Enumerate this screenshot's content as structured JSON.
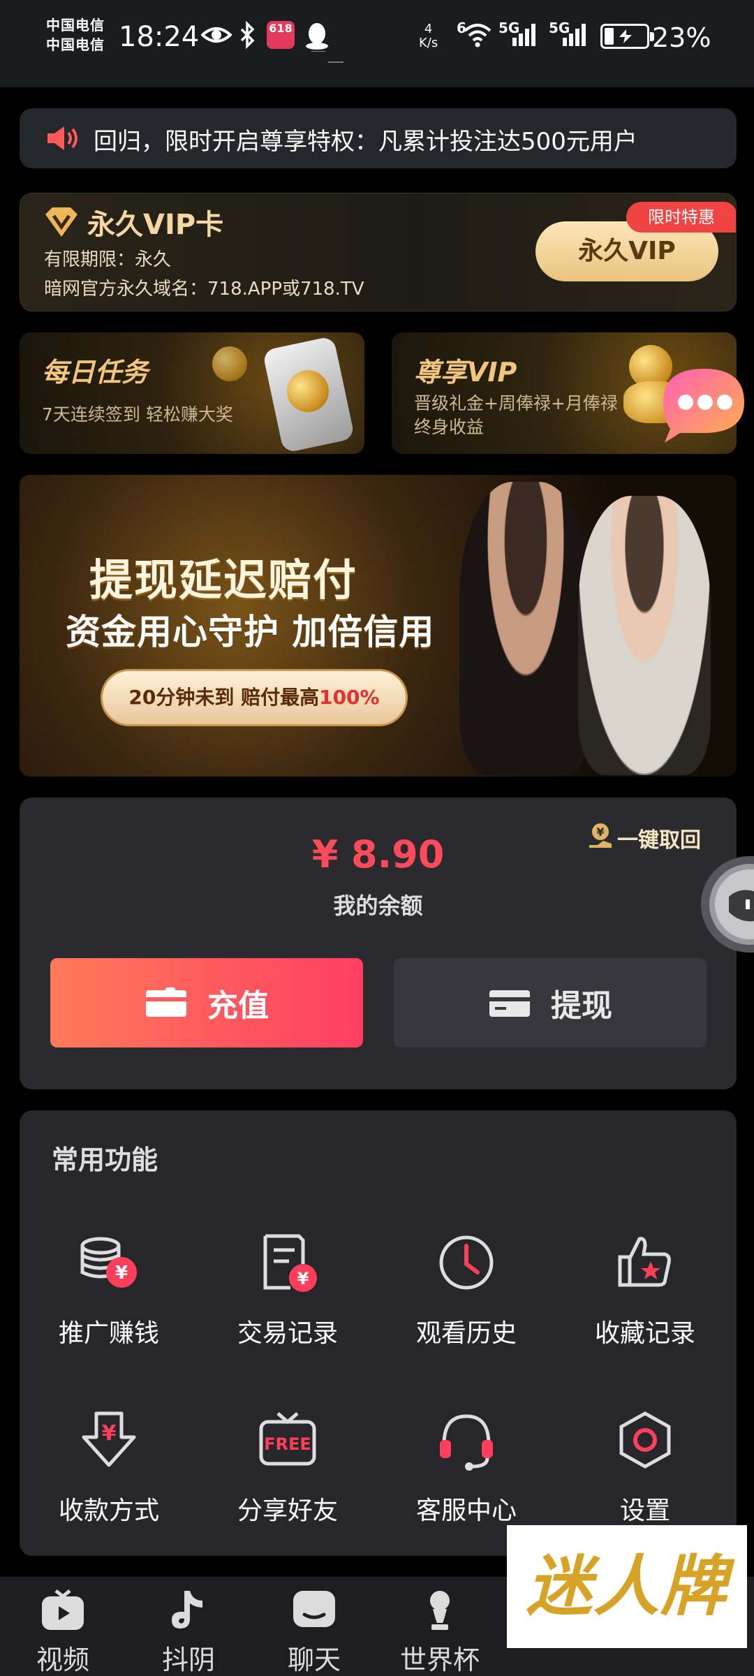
{
  "status_bar": {
    "carrier_lines": [
      "中国电信",
      "中国电信"
    ],
    "time": "18:24",
    "badge_618": "618",
    "speed_value": "4",
    "speed_unit": "K/s",
    "net_wifi": "6",
    "net_sim1": "5G",
    "net_sim2": "5G",
    "battery_percent": "23%",
    "battery_level": 0.23
  },
  "marquee": {
    "text": "回归，限时开启尊享特权：凡累计投注达500元用户"
  },
  "vip_card": {
    "title": "永久VIP卡",
    "validity": "有限期限：永久",
    "domain_line": "暗网官方永久域名：718.APP或718.TV",
    "button_label": "永久VIP",
    "tag": "限时特惠"
  },
  "promos": [
    {
      "title": "每日任务",
      "subtitle": "7天连续签到 轻松赚大奖"
    },
    {
      "title": "尊享VIP",
      "subtitle_lines": [
        "晋级礼金+周俸禄+月俸禄",
        "终身收益"
      ]
    }
  ],
  "banner": {
    "headline": "提现延迟赔付",
    "subheadline": "资金用心守护 加倍信用",
    "pill_prefix": "20分钟未到 赔付最高",
    "pill_highlight": "100%"
  },
  "balance": {
    "amount": "¥ 8.90",
    "label": "我的余额",
    "retrieve_label": "一键取回",
    "recharge_label": "充值",
    "withdraw_label": "提现"
  },
  "features": {
    "title": "常用功能",
    "items": [
      {
        "label": "推广赚钱",
        "icon": "coins-yen-icon"
      },
      {
        "label": "交易记录",
        "icon": "receipt-yen-icon"
      },
      {
        "label": "观看历史",
        "icon": "clock-icon"
      },
      {
        "label": "收藏记录",
        "icon": "thumbs-up-star-icon"
      },
      {
        "label": "收款方式",
        "icon": "download-yen-icon"
      },
      {
        "label": "分享好友",
        "icon": "free-tv-icon"
      },
      {
        "label": "客服中心",
        "icon": "headset-icon"
      },
      {
        "label": "设置",
        "icon": "settings-hexagon-icon"
      }
    ]
  },
  "watermark": {
    "text": "迷人牌"
  },
  "bottom_nav": {
    "items": [
      {
        "label": "视频",
        "icon": "tv-play-icon"
      },
      {
        "label": "抖阴",
        "icon": "tiktok-icon"
      },
      {
        "label": "聊天",
        "icon": "chat-icon"
      },
      {
        "label": "世界杯",
        "icon": "trophy-icon"
      }
    ]
  },
  "colors": {
    "accent_red": "#ff4a5b",
    "gold": "#f4d7a3",
    "card_bg": "#2a2a2f",
    "page_bg": "#000000"
  }
}
